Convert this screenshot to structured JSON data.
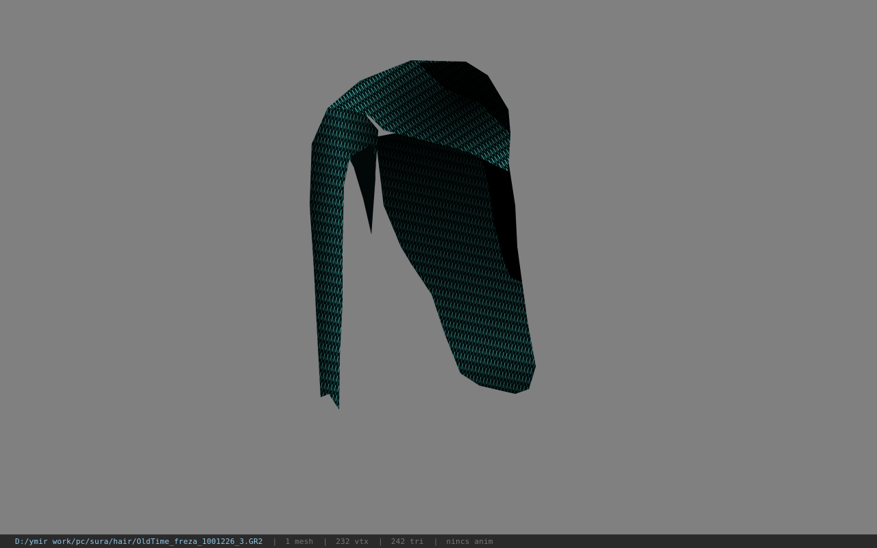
{
  "viewer": {
    "background_color": "#808080",
    "model": {
      "subject": "hair",
      "primary_color": "#46c4c0",
      "shadow_color": "#020606"
    }
  },
  "status_bar": {
    "file_path": "D:/ymir work/pc/sura/hair/OldTime_freza_1001226_3.GR2",
    "separator": "|",
    "mesh_count": "1 mesh",
    "vertex_count": "232 vtx",
    "triangle_count": "242 tri",
    "anim_status": "nincs anim"
  }
}
